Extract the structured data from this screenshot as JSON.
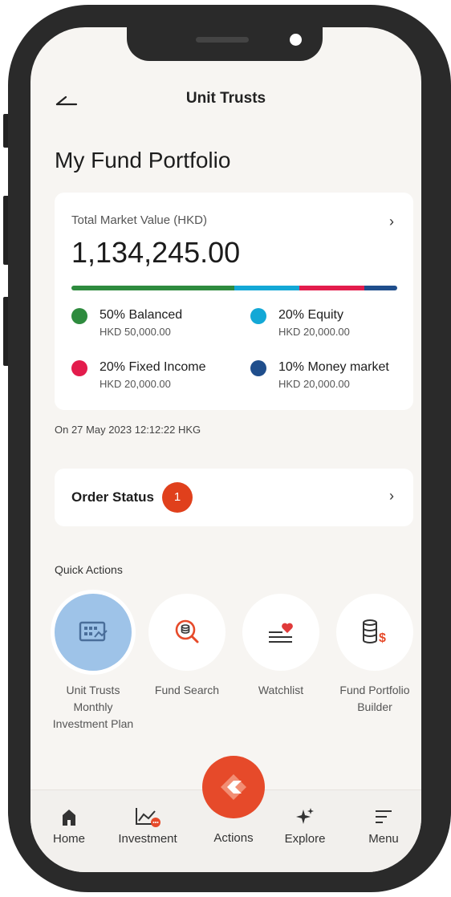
{
  "header": {
    "title": "Unit Trusts"
  },
  "page": {
    "title": "My Fund Portfolio"
  },
  "portfolio": {
    "label": "Total Market Value (HKD)",
    "value": "1,134,245.00",
    "allocations": [
      {
        "pct": 50,
        "name": "50% Balanced",
        "amount": "HKD 50,000.00",
        "color": "#2e8b3e"
      },
      {
        "pct": 20,
        "name": "20% Equity",
        "amount": "HKD 20,000.00",
        "color": "#13a8d6"
      },
      {
        "pct": 20,
        "name": "20% Fixed Income",
        "amount": "HKD 20,000.00",
        "color": "#e31c4c"
      },
      {
        "pct": 10,
        "name": "10% Money market",
        "amount": "HKD 20,000.00",
        "color": "#1f4e8c"
      }
    ],
    "timestamp": "On 27 May 2023 12:12:22 HKG"
  },
  "order_status": {
    "label": "Order Status",
    "count": "1"
  },
  "quick_actions": {
    "title": "Quick Actions",
    "items": [
      {
        "label": "Unit Trusts Monthly Investment Plan",
        "icon": "calendar-chart-icon"
      },
      {
        "label": "Fund Search",
        "icon": "fund-search-icon"
      },
      {
        "label": "Watchlist",
        "icon": "watchlist-heart-icon"
      },
      {
        "label": "Fund Portfolio Builder",
        "icon": "coins-dollar-icon"
      }
    ]
  },
  "nav": {
    "items": [
      {
        "label": "Home",
        "icon": "home-icon"
      },
      {
        "label": "Investment",
        "icon": "investment-chart-icon"
      },
      {
        "label": "Actions",
        "icon": "actions-icon"
      },
      {
        "label": "Explore",
        "icon": "sparkle-icon"
      },
      {
        "label": "Menu",
        "icon": "menu-icon"
      }
    ]
  },
  "colors": {
    "accent": "#e64a2a",
    "active_tile": "#9ec3e8",
    "background": "#f7f5f2"
  }
}
